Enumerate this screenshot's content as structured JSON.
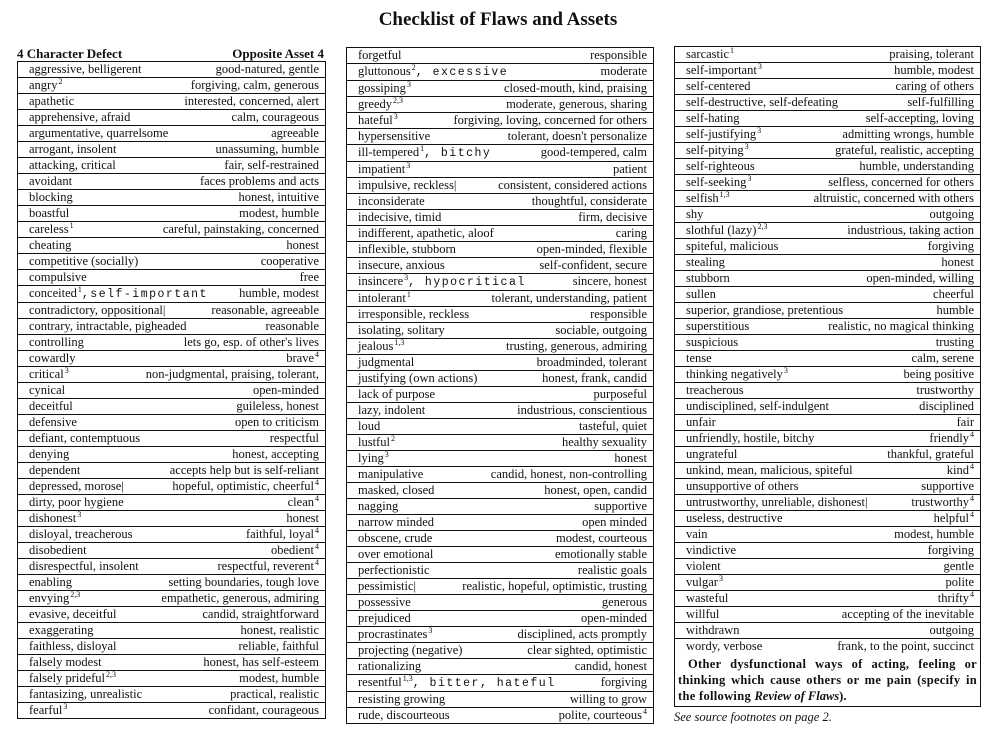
{
  "title": "Checklist of Flaws and Assets",
  "header": {
    "defect": "4 Character Defect",
    "asset": "Opposite Asset 4"
  },
  "columns": [
    {
      "rows": [
        {
          "defect": "aggressive, belligerent",
          "asset": "good-natured, gentle"
        },
        {
          "defect": "angry",
          "defect_sup": "2",
          "asset": "forgiving, calm, generous"
        },
        {
          "defect": "apathetic",
          "asset": "interested, concerned, alert"
        },
        {
          "defect": "apprehensive, afraid",
          "asset": "calm, courageous"
        },
        {
          "defect": "argumentative, quarrelsome",
          "asset": "agreeable"
        },
        {
          "defect": "arrogant, insolent",
          "asset": "unassuming, humble"
        },
        {
          "defect": "attacking, critical",
          "asset": "fair, self-restrained"
        },
        {
          "defect": "avoidant",
          "asset": "faces problems and acts"
        },
        {
          "defect": "blocking",
          "asset": "honest, intuitive"
        },
        {
          "defect": "boastful",
          "asset": "modest, humble"
        },
        {
          "defect": "careless",
          "defect_sup": "1",
          "asset": "careful, painstaking, concerned"
        },
        {
          "defect": "cheating",
          "asset": "honest"
        },
        {
          "defect": "competitive (socially)",
          "asset": "cooperative"
        },
        {
          "defect": "compulsive",
          "asset": "free"
        },
        {
          "defect": "conceited",
          "defect_sup": "1",
          "defect_extra": ",self-important",
          "asset": "humble, modest"
        },
        {
          "defect": "contradictory, oppositional|",
          "asset": "reasonable, agreeable"
        },
        {
          "defect": "contrary, intractable, pigheaded",
          "asset": "reasonable"
        },
        {
          "defect": "controlling",
          "asset": "lets go, esp. of other's lives"
        },
        {
          "defect": "cowardly",
          "asset": "brave",
          "asset_sup": "4"
        },
        {
          "defect": "critical",
          "defect_sup": "3",
          "asset": "non-judgmental, praising, tolerant,"
        },
        {
          "defect": "cynical",
          "asset": "open-minded"
        },
        {
          "defect": "deceitful",
          "asset": "guileless, honest"
        },
        {
          "defect": "defensive",
          "asset": "open to criticism"
        },
        {
          "defect": "defiant, contemptuous",
          "asset": "respectful"
        },
        {
          "defect": "denying",
          "asset": "honest, accepting"
        },
        {
          "defect": "dependent",
          "asset": "accepts help but is self-reliant"
        },
        {
          "defect": "depressed, morose|",
          "asset": "hopeful, optimistic, cheerful",
          "asset_sup": "4"
        },
        {
          "defect": "dirty, poor hygiene",
          "asset": "clean",
          "asset_sup": "4"
        },
        {
          "defect": "dishonest",
          "defect_sup": "3",
          "asset": "honest"
        },
        {
          "defect": "disloyal, treacherous",
          "asset": "faithful, loyal",
          "asset_sup": "4"
        },
        {
          "defect": "disobedient",
          "asset": "obedient",
          "asset_sup": "4"
        },
        {
          "defect": "disrespectful, insolent",
          "asset": "respectful, reverent",
          "asset_sup": "4"
        },
        {
          "defect": "enabling",
          "asset": "setting boundaries, tough love"
        },
        {
          "defect": "envying",
          "defect_sup": "2,3",
          "asset": "empathetic, generous, admiring"
        },
        {
          "defect": "evasive, deceitful",
          "asset": "candid, straightforward"
        },
        {
          "defect": "exaggerating",
          "asset": "honest, realistic"
        },
        {
          "defect": "faithless, disloyal",
          "asset": "reliable, faithful"
        },
        {
          "defect": "falsely modest",
          "asset": "honest, has self-esteem"
        },
        {
          "defect": "falsely prideful",
          "defect_sup": "2,3",
          "asset": "modest, humble"
        },
        {
          "defect": "fantasizing, unrealistic",
          "asset": "practical, realistic"
        },
        {
          "defect": "fearful",
          "defect_sup": "3",
          "asset": "confidant, courageous"
        }
      ]
    },
    {
      "rows": [
        {
          "defect": "forgetful",
          "asset": "responsible"
        },
        {
          "defect": "gluttonous",
          "defect_sup": "2",
          "defect_extra": ", excessive",
          "asset": "moderate"
        },
        {
          "defect": "gossiping",
          "defect_sup": "3",
          "asset": "closed-mouth, kind, praising"
        },
        {
          "defect": "greedy",
          "defect_sup": "2,3",
          "asset": "moderate, generous, sharing"
        },
        {
          "defect": "hateful",
          "defect_sup": "3",
          "asset": "forgiving, loving, concerned for others"
        },
        {
          "defect": "hypersensitive",
          "asset": "tolerant, doesn't personalize"
        },
        {
          "defect": "ill-tempered",
          "defect_sup": "1",
          "defect_extra": ", bitchy",
          "asset": "good-tempered, calm"
        },
        {
          "defect": "impatient",
          "defect_sup": "3",
          "asset": "patient"
        },
        {
          "defect": "impulsive, reckless|",
          "asset": "consistent, considered actions"
        },
        {
          "defect": "inconsiderate",
          "asset": "thoughtful, considerate"
        },
        {
          "defect": "indecisive, timid",
          "asset": "firm, decisive"
        },
        {
          "defect": "indifferent, apathetic, aloof",
          "asset": "caring"
        },
        {
          "defect": "inflexible, stubborn",
          "asset": "open-minded, flexible"
        },
        {
          "defect": "insecure, anxious",
          "asset": "self-confident, secure"
        },
        {
          "defect": "insincere",
          "defect_sup": "3",
          "defect_extra": ", hypocritical",
          "asset": "sincere, honest"
        },
        {
          "defect": "intolerant",
          "defect_sup": "1",
          "asset": "tolerant, understanding, patient"
        },
        {
          "defect": "irresponsible, reckless",
          "asset": "responsible"
        },
        {
          "defect": "isolating, solitary",
          "asset": "sociable, outgoing"
        },
        {
          "defect": "jealous",
          "defect_sup": "1,3",
          "asset": "trusting, generous, admiring"
        },
        {
          "defect": "judgmental",
          "asset": "broadminded, tolerant"
        },
        {
          "defect": "justifying (own actions)",
          "asset": "honest, frank, candid"
        },
        {
          "defect": "lack of purpose",
          "asset": "purposeful"
        },
        {
          "defect": "lazy, indolent",
          "asset": "industrious, conscientious"
        },
        {
          "defect": "loud",
          "asset": "tasteful, quiet"
        },
        {
          "defect": "lustful",
          "defect_sup": "2",
          "asset": "healthy sexuality"
        },
        {
          "defect": "lying",
          "defect_sup": "3",
          "asset": "honest"
        },
        {
          "defect": "manipulative",
          "asset": "candid, honest, non-controlling"
        },
        {
          "defect": "masked, closed",
          "asset": "honest, open, candid"
        },
        {
          "defect": "nagging",
          "asset": "supportive"
        },
        {
          "defect": "narrow minded",
          "asset": "open minded"
        },
        {
          "defect": "obscene, crude",
          "asset": "modest, courteous"
        },
        {
          "defect": "over emotional",
          "asset": "emotionally stable"
        },
        {
          "defect": "perfectionistic",
          "asset": "realistic goals"
        },
        {
          "defect": "pessimistic|",
          "asset": "realistic, hopeful, optimistic, trusting"
        },
        {
          "defect": "possessive",
          "asset": "generous"
        },
        {
          "defect": "prejudiced",
          "asset": "open-minded"
        },
        {
          "defect": "procrastinates",
          "defect_sup": "3",
          "asset": "disciplined, acts promptly"
        },
        {
          "defect": "projecting (negative)",
          "asset": "clear sighted, optimistic"
        },
        {
          "defect": "rationalizing",
          "asset": "candid, honest"
        },
        {
          "defect": "resentful",
          "defect_sup": "1,3",
          "defect_extra": ", bitter, hateful",
          "asset": "forgiving"
        },
        {
          "defect": "resisting growing",
          "asset": "willing to grow"
        },
        {
          "defect": "rude, discourteous",
          "asset": "polite, courteous",
          "asset_sup": "4"
        }
      ]
    },
    {
      "rows": [
        {
          "defect": "sarcastic",
          "defect_sup": "1",
          "asset": "praising, tolerant"
        },
        {
          "defect": "self-important",
          "defect_sup": "3",
          "asset": "humble, modest"
        },
        {
          "defect": "self-centered",
          "asset": "caring of others"
        },
        {
          "defect": "self-destructive, self-defeating",
          "asset": "self-fulfilling"
        },
        {
          "defect": "self-hating",
          "asset": "self-accepting, loving"
        },
        {
          "defect": "self-justifying",
          "defect_sup": "3",
          "asset": "admitting wrongs, humble"
        },
        {
          "defect": "self-pitying",
          "defect_sup": "3",
          "asset": "grateful, realistic, accepting"
        },
        {
          "defect": "self-righteous",
          "asset": "humble, understanding"
        },
        {
          "defect": "self-seeking",
          "defect_sup": "3",
          "asset": "selfless, concerned for others"
        },
        {
          "defect": "selfish",
          "defect_sup": "1,3",
          "asset": "altruistic, concerned with others"
        },
        {
          "defect": "shy",
          "asset": "outgoing"
        },
        {
          "defect": "slothful (lazy)",
          "defect_sup": "2,3",
          "asset": "industrious, taking action"
        },
        {
          "defect": "spiteful, malicious",
          "asset": "forgiving"
        },
        {
          "defect": "stealing",
          "asset": "honest"
        },
        {
          "defect": "stubborn",
          "asset": "open-minded, willing"
        },
        {
          "defect": "sullen",
          "asset": "cheerful"
        },
        {
          "defect": "superior, grandiose, pretentious",
          "asset": "humble"
        },
        {
          "defect": "superstitious",
          "asset": "realistic, no magical thinking"
        },
        {
          "defect": "suspicious",
          "asset": "trusting"
        },
        {
          "defect": "tense",
          "asset": "calm, serene"
        },
        {
          "defect": "thinking  negatively",
          "defect_sup": "3",
          "asset": "being positive"
        },
        {
          "defect": "treacherous",
          "asset": "trustworthy"
        },
        {
          "defect": "undisciplined, self-indulgent",
          "asset": "disciplined"
        },
        {
          "defect": "unfair",
          "asset": "fair"
        },
        {
          "defect": "unfriendly, hostile, bitchy",
          "asset": "friendly",
          "asset_sup": "4"
        },
        {
          "defect": "ungrateful",
          "asset": "thankful, grateful"
        },
        {
          "defect": "unkind, mean, malicious, spiteful",
          "asset": "kind",
          "asset_sup": "4"
        },
        {
          "defect": "unsupportive of others",
          "asset": "supportive"
        },
        {
          "defect": "untrustworthy, unreliable, dishonest|",
          "asset": "trustworthy",
          "asset_sup": "4"
        },
        {
          "defect": "useless, destructive",
          "asset": "helpful",
          "asset_sup": "4"
        },
        {
          "defect": "vain",
          "asset": "modest, humble"
        },
        {
          "defect": "vindictive",
          "asset": "forgiving"
        },
        {
          "defect": "violent",
          "asset": "gentle"
        },
        {
          "defect": "vulgar",
          "defect_sup": "3",
          "asset": "polite"
        },
        {
          "defect": "wasteful",
          "asset": "thrifty",
          "asset_sup": "4"
        },
        {
          "defect": "willful",
          "asset": "accepting of the inevitable"
        },
        {
          "defect": "withdrawn",
          "asset": "outgoing"
        },
        {
          "defect": "wordy, verbose",
          "asset": "frank, to the point, succinct"
        }
      ],
      "footer": {
        "text_before": "Other dysfunctional ways of acting, feeling or thinking which cause others or me pain (specify in the following ",
        "text_italic": "Review of Flaws",
        "text_after": ")."
      },
      "note": "See source footnotes on page 2."
    }
  ]
}
